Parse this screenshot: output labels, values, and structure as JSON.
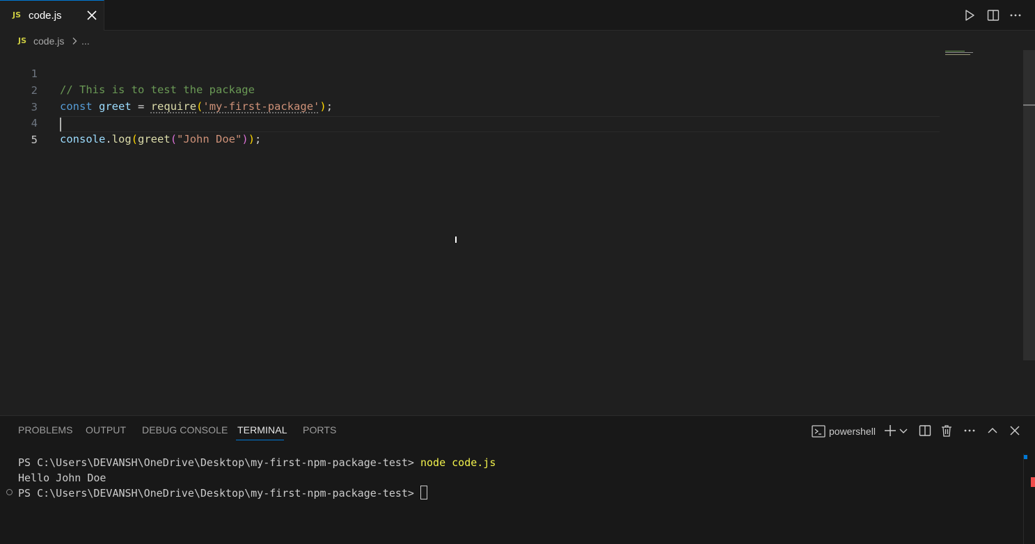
{
  "tab": {
    "lang_badge": "JS",
    "filename": "code.js"
  },
  "breadcrumb": {
    "lang_badge": "JS",
    "file": "code.js",
    "more": "..."
  },
  "editor": {
    "line_numbers": [
      "1",
      "2",
      "3",
      "4",
      "5"
    ],
    "active_line": 5,
    "lines": {
      "l1": {
        "comment": "// This is to test the package"
      },
      "l2": {
        "kw": "const",
        "var": "greet",
        "op": "=",
        "fn": "require",
        "open": "(",
        "str": "'my-first-package'",
        "close": ")",
        "semi": ";"
      },
      "l4": {
        "obj": "console",
        "dot": ".",
        "method": "log",
        "open1": "(",
        "fn": "greet",
        "open2": "(",
        "str": "\"John Doe\"",
        "close2": ")",
        "close1": ")",
        "semi": ";"
      }
    }
  },
  "panel": {
    "tabs": [
      "PROBLEMS",
      "OUTPUT",
      "DEBUG CONSOLE",
      "TERMINAL",
      "PORTS"
    ],
    "active_tab": "TERMINAL",
    "shell_label": "powershell",
    "terminal": {
      "prompt": "PS C:\\Users\\DEVANSH\\OneDrive\\Desktop\\my-first-npm-package-test>",
      "command": "node code.js",
      "output": "Hello John Doe",
      "prompt2": "PS C:\\Users\\DEVANSH\\OneDrive\\Desktop\\my-first-npm-package-test>"
    }
  },
  "colors": {
    "accent": "#0078d4",
    "js_badge": "#cbcb41",
    "terminal_command": "#f1f14c"
  },
  "icons": [
    "close-icon",
    "run-icon",
    "split-editor-icon",
    "more-icon",
    "chevron-right-icon",
    "terminal-shell-icon",
    "add-icon",
    "chevron-down-icon",
    "trash-icon",
    "chevron-up-icon"
  ]
}
